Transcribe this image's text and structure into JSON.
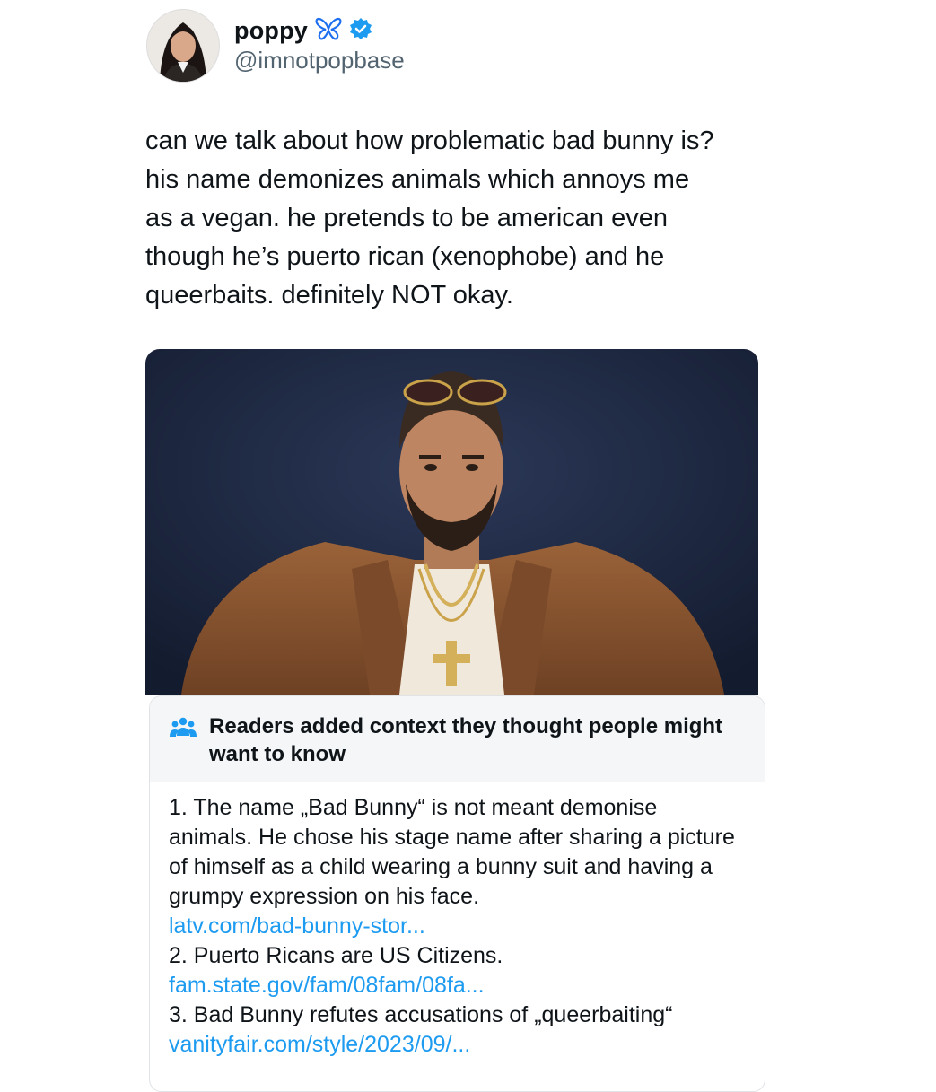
{
  "tweet": {
    "display_name": "poppy",
    "handle": "@imnotpopbase",
    "name_emoji": "butterfly-icon",
    "verified_icon": "verified-badge-icon",
    "text_lines": [
      "can we talk about how problematic bad bunny is?",
      "his name demonizes animals which annoys me",
      "as a vegan. he pretends to be american even",
      "though he’s puerto rican (xenophobe) and he",
      "queerbaits. definitely NOT okay."
    ]
  },
  "community_note": {
    "icon": "people-icon",
    "title": "Readers added context they thought people might want to know",
    "items": [
      {
        "text": "1. The name „Bad Bunny“ is not meant demonise animals. He chose his stage name after sharing a picture of himself as a child wearing a bunny suit and having a grumpy expression on his face.",
        "link": "latv.com/bad-bunny-stor..."
      },
      {
        "text": "2. Puerto Ricans are US Citizens.",
        "link": "fam.state.gov/fam/08fam/08fa..."
      },
      {
        "text": "3. Bad Bunny refutes accusations of „queerbaiting“",
        "link": "vanityfair.com/style/2023/09/..."
      }
    ]
  },
  "colors": {
    "link": "#1d9bf0",
    "verified": "#1d9bf0",
    "butterfly": "#1e6ff0",
    "photo_background": "#1f2a44",
    "jacket": "#8a5530"
  }
}
